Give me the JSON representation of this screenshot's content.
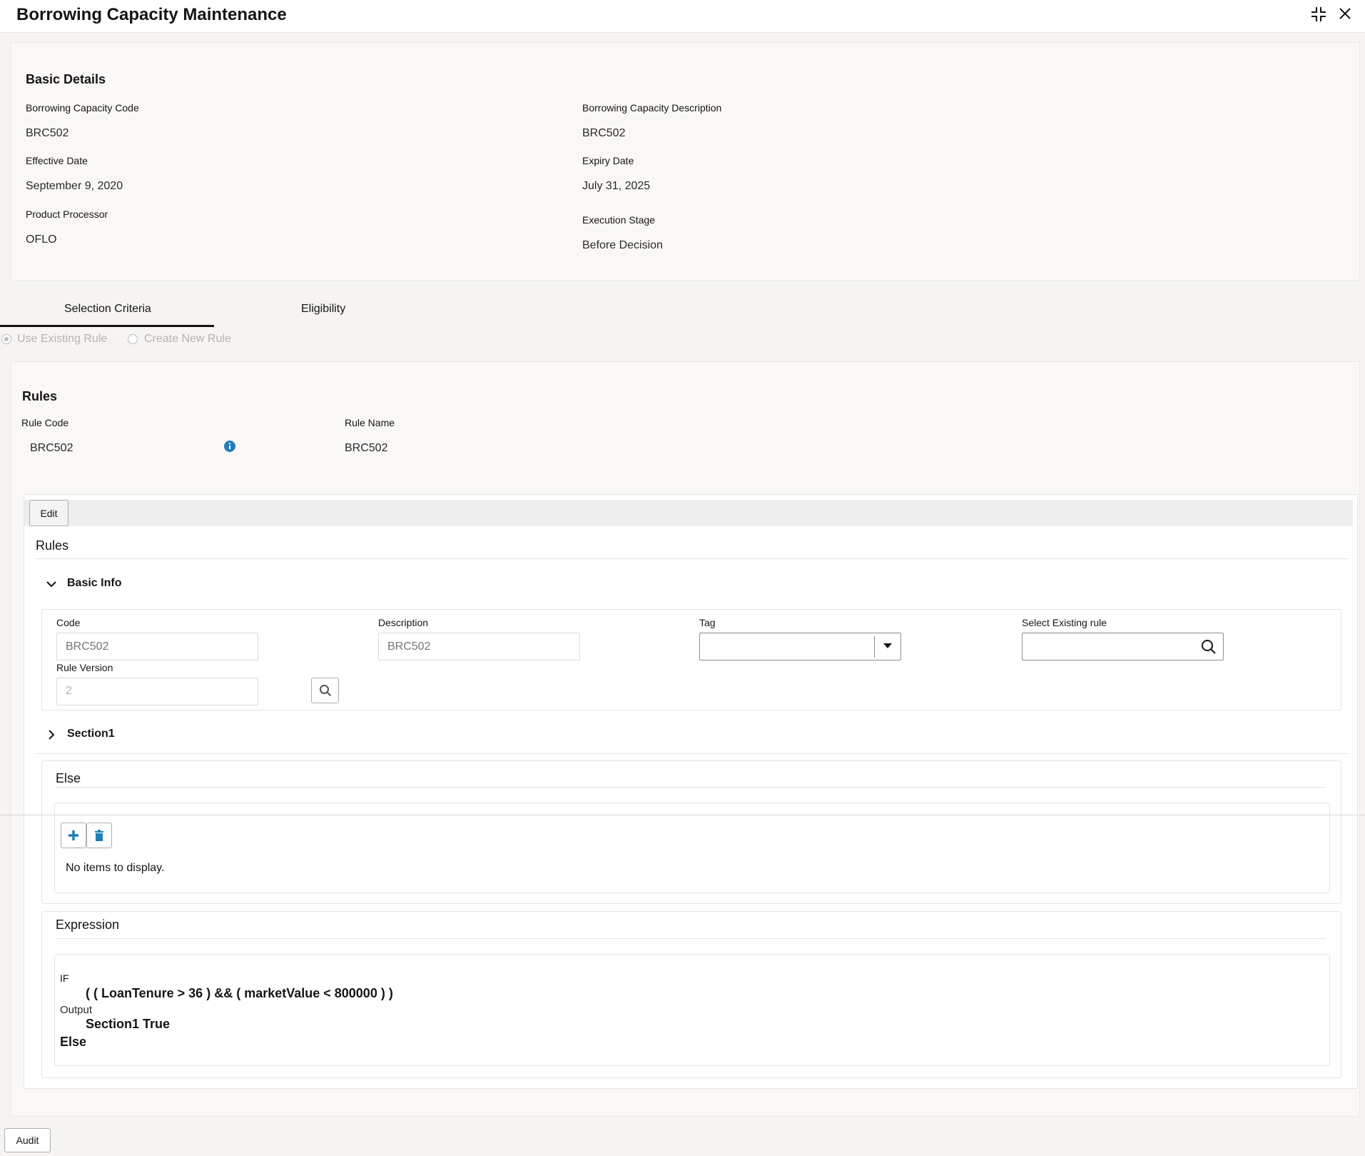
{
  "header": {
    "title": "Borrowing Capacity Maintenance",
    "icons": [
      "compress-icon",
      "close-icon"
    ]
  },
  "basic_details": {
    "heading": "Basic Details",
    "fields": [
      {
        "label": "Borrowing Capacity Code",
        "value": "BRC502"
      },
      {
        "label": "Borrowing Capacity Description",
        "value": "BRC502"
      },
      {
        "label": "Effective Date",
        "value": "September 9, 2020"
      },
      {
        "label": "Expiry Date",
        "value": "July 31, 2025"
      },
      {
        "label": "Product Processor",
        "value": "OFLO"
      },
      {
        "label": "Execution Stage",
        "value": "Before Decision"
      }
    ]
  },
  "tabs": [
    {
      "label": "Selection Criteria",
      "active": true
    },
    {
      "label": "Eligibility",
      "active": false
    }
  ],
  "radios": [
    {
      "label": "Use Existing Rule",
      "checked": true
    },
    {
      "label": "Create New Rule",
      "checked": false
    }
  ],
  "rules": {
    "heading": "Rules",
    "rule_code_label": "Rule Code",
    "rule_code": "BRC502",
    "rule_name_label": "Rule Name",
    "rule_name": "BRC502",
    "edit_label": "Edit",
    "inner_heading": "Rules",
    "basic_info": {
      "title": "Basic Info",
      "code_label": "Code",
      "code_placeholder": "BRC502",
      "description_label": "Description",
      "description_placeholder": "BRC502",
      "tag_label": "Tag",
      "tag_value": "",
      "select_existing_label": "Select Existing rule",
      "select_existing_value": "",
      "rule_version_label": "Rule Version",
      "rule_version": "2"
    },
    "section1_title": "Section1",
    "else": {
      "title": "Else",
      "empty": "No items to display."
    },
    "expression": {
      "title": "Expression",
      "if_label": "IF",
      "condition": "( ( LoanTenure > 36 ) && ( marketValue < 800000 ) )",
      "output_label": "Output",
      "output": "Section1 True",
      "else_label": "Else"
    }
  },
  "footer": {
    "audit_label": "Audit"
  },
  "colors": {
    "accent": "#227fb8",
    "tab_underline": "#161513"
  }
}
